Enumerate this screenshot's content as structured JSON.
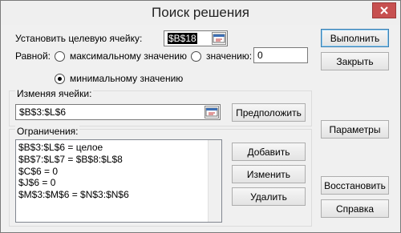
{
  "window": {
    "title": "Поиск решения"
  },
  "target": {
    "label": "Установить целевую ячейку:",
    "value": "$B$18"
  },
  "equal_to": {
    "label": "Равной:",
    "option_max": "максимальному значению",
    "option_value": "значению:",
    "value_input": "0",
    "option_min": "минимальному значению",
    "selected": "min"
  },
  "changing": {
    "group_label": "Изменяя ячейки:",
    "value": "$B$3:$L$6",
    "guess_button": "Предположить"
  },
  "constraints": {
    "group_label": "Ограничения:",
    "items": [
      "$B$3:$L$6 = целое",
      "$B$7:$L$7 = $B$8:$L$8",
      "$C$6 = 0",
      "$J$6 = 0",
      "$M$3:$M$6 = $N$3:$N$6"
    ],
    "add_button": "Добавить",
    "change_button": "Изменить",
    "delete_button": "Удалить"
  },
  "side_buttons": {
    "solve": "Выполнить",
    "close": "Закрыть",
    "options": "Параметры",
    "reset": "Восстановить",
    "help": "Справка"
  },
  "colors": {
    "close_button": "#c75050",
    "default_button_border": "#3c7fb1",
    "selection": "#000000"
  }
}
